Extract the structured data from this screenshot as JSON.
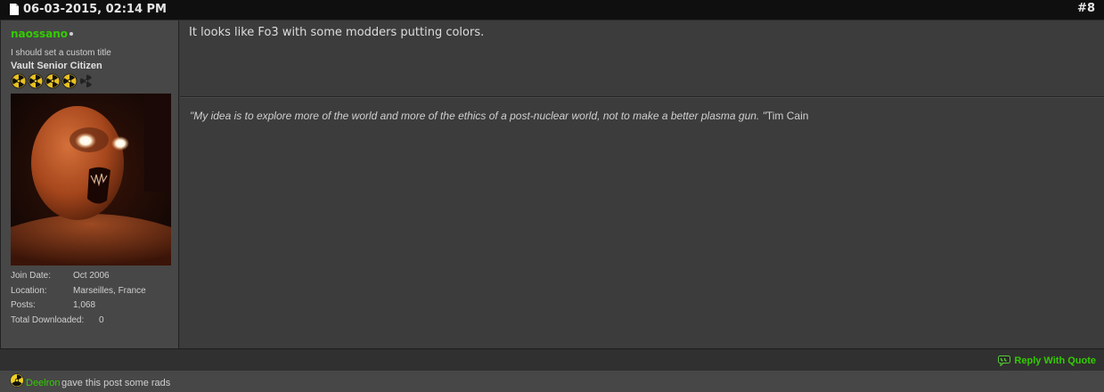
{
  "post": {
    "date": "06-03-2015, 02:14 PM",
    "number": "#8"
  },
  "user": {
    "name": "naossano",
    "title": "I should set a custom title",
    "rank": "Vault Senior Citizen",
    "rads_filled": 4,
    "rads_total": 5,
    "avatar_icon": "avatar-orange-face",
    "info": [
      {
        "label": "Join Date:",
        "value": "Oct 2006"
      },
      {
        "label": "Location:",
        "value": "Marseilles, France"
      },
      {
        "label": "Posts:",
        "value": "1,068"
      },
      {
        "label": "Total Downloaded:",
        "value": "0"
      }
    ]
  },
  "message": {
    "text": "It looks like Fo3 with some modders putting colors."
  },
  "signature": {
    "quote": "\"My idea is to explore more of the world and more of the ethics of a post-nuclear world, not to make a better plasma gun. \"",
    "author": "Tim Cain"
  },
  "footer": {
    "reply_label": "Reply With Quote"
  },
  "rads_given": {
    "user": "Deelron",
    "text": "gave this post some rads"
  },
  "colors": {
    "username": "#33cc00",
    "background": "#3a3a3a",
    "header": "#0f0f0f"
  }
}
